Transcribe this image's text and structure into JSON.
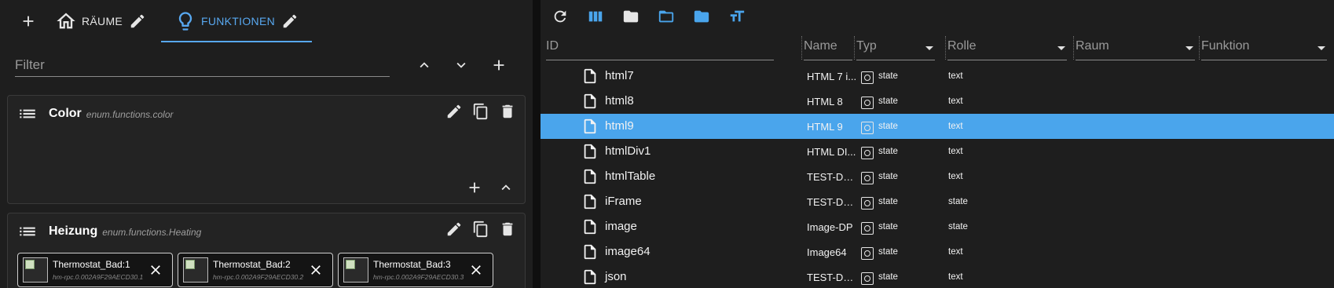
{
  "left": {
    "tabs": [
      {
        "label": "RÄUME",
        "icon": "home-icon"
      },
      {
        "label": "FUNKTIONEN",
        "icon": "lightbulb-icon"
      }
    ],
    "filter": {
      "placeholder": "Filter"
    },
    "cards": [
      {
        "title": "Color",
        "subtitle": "enum.functions.color",
        "members": []
      },
      {
        "title": "Heizung",
        "subtitle": "enum.functions.Heating",
        "members": [
          {
            "name": "Thermostat_Bad:1",
            "id": "hm-rpc.0.002A9F29AECD30.1"
          },
          {
            "name": "Thermostat_Bad:2",
            "id": "hm-rpc.0.002A9F29AECD30.2"
          },
          {
            "name": "Thermostat_Bad:3",
            "id": "hm-rpc.0.002A9F29AECD30.3"
          }
        ]
      }
    ]
  },
  "right": {
    "columns": {
      "id": "ID",
      "name": "Name",
      "type": "Typ",
      "role": "Rolle",
      "room": "Raum",
      "function": "Funktion"
    },
    "rows": [
      {
        "id": "html7",
        "name": "HTML 7 i...",
        "type": "state",
        "role": "text",
        "selected": false
      },
      {
        "id": "html8",
        "name": "HTML 8",
        "type": "state",
        "role": "text",
        "selected": false
      },
      {
        "id": "html9",
        "name": "HTML 9",
        "type": "state",
        "role": "text",
        "selected": true
      },
      {
        "id": "htmlDiv1",
        "name": "HTML DI...",
        "type": "state",
        "role": "text",
        "selected": false
      },
      {
        "id": "htmlTable",
        "name": "TEST-DP ...",
        "type": "state",
        "role": "text",
        "selected": false
      },
      {
        "id": "iFrame",
        "name": "TEST-DP ...",
        "type": "state",
        "role": "state",
        "selected": false
      },
      {
        "id": "image",
        "name": "Image-DP",
        "type": "state",
        "role": "state",
        "selected": false
      },
      {
        "id": "image64",
        "name": "Image64",
        "type": "state",
        "role": "text",
        "selected": false
      },
      {
        "id": "json",
        "name": "TEST-DP ...",
        "type": "state",
        "role": "text",
        "selected": false
      }
    ]
  },
  "colors": {
    "accent": "#58a8f0",
    "selected_row": "#4aa5ec",
    "panel": "#1e1e1e"
  }
}
